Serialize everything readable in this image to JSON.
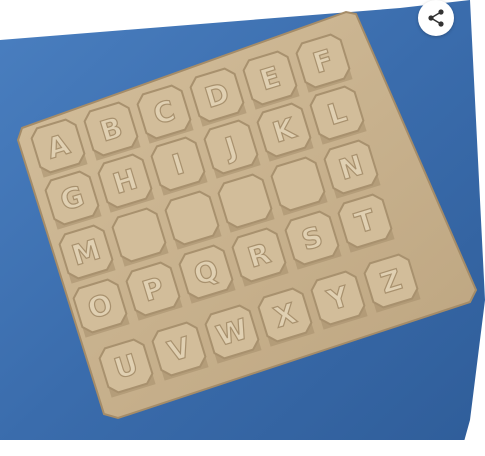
{
  "image": {
    "letters": [
      "A",
      "B",
      "C",
      "D",
      "E",
      "F",
      "G",
      "H",
      "I",
      "J",
      "K",
      "L",
      "M",
      "N",
      "O",
      "P",
      "Q",
      "R",
      "S",
      "T",
      "U",
      "V",
      "W",
      "X",
      "Y",
      "Z"
    ],
    "blank_count": 4,
    "colors": {
      "cloth": "#3b6fb0",
      "mold": "#c9b391",
      "tile": "#d2bd9a",
      "tile_edge": "#a8916e",
      "letter": "#e0d0b2"
    }
  },
  "overlay": {
    "share_icon": "share-icon"
  }
}
